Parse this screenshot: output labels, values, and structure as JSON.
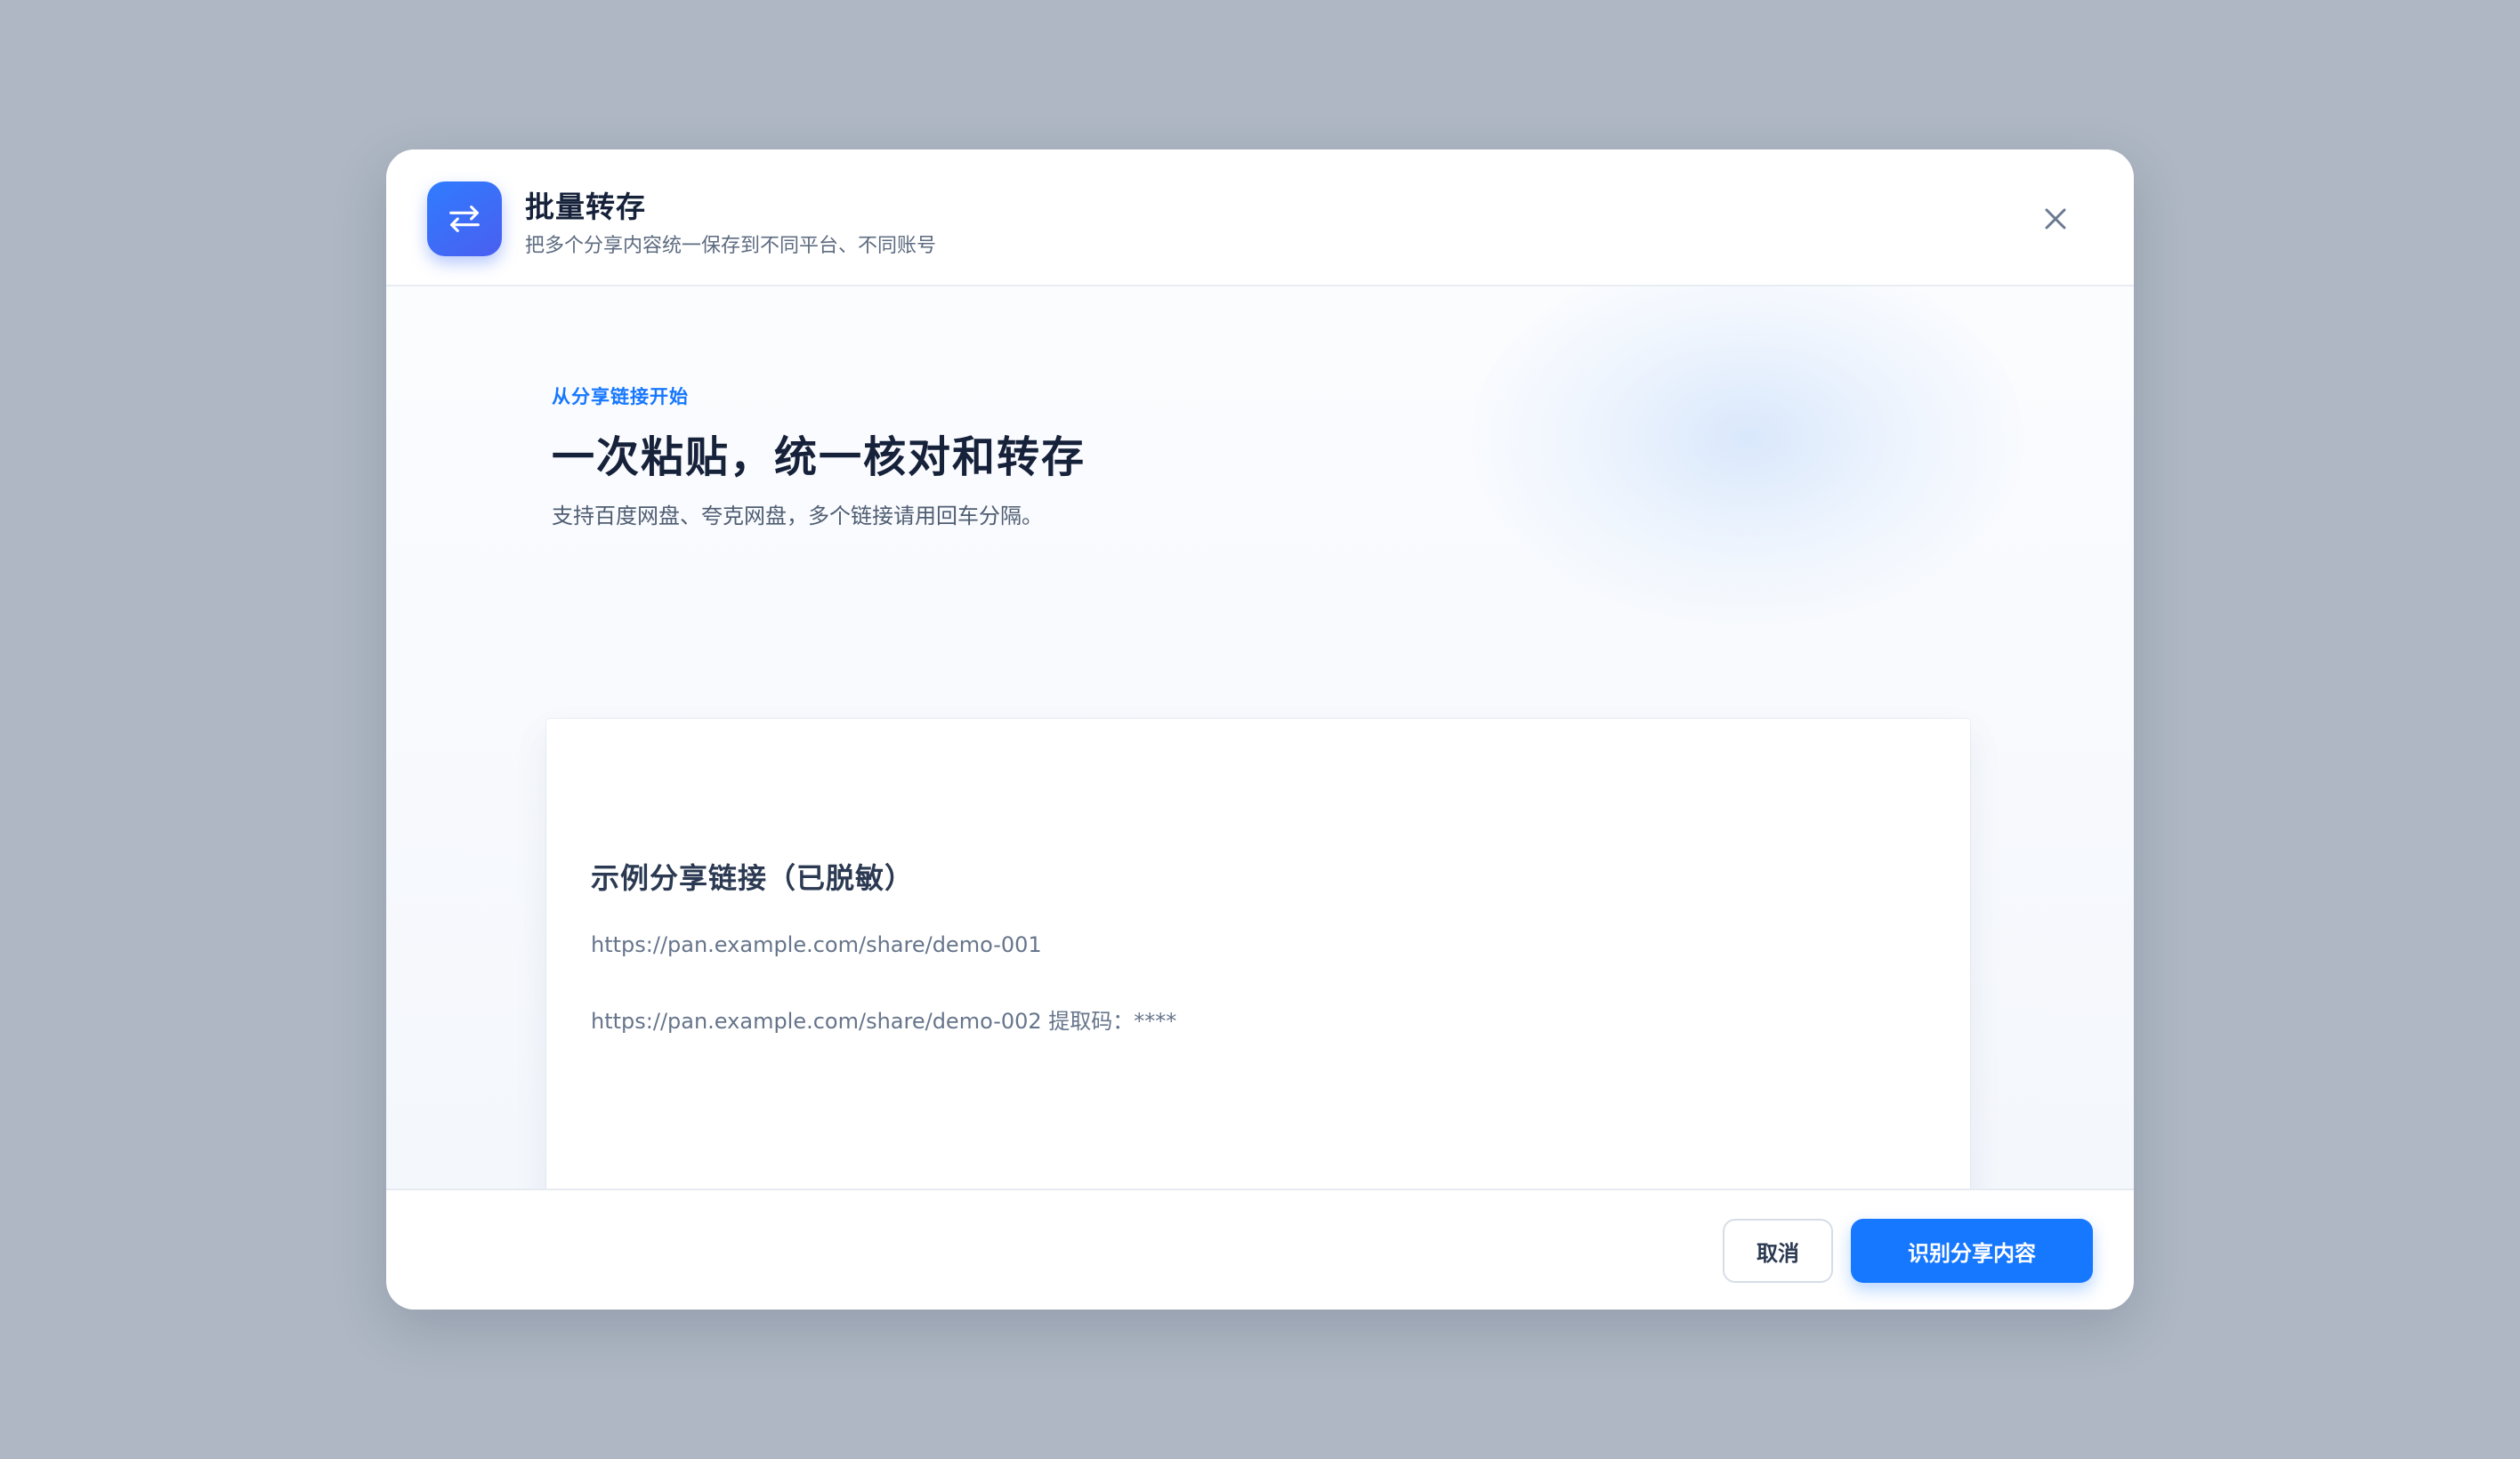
{
  "dialog": {
    "title": "批量转存",
    "subtitle": "把多个分享内容统一保存到不同平台、不同账号",
    "icon": "transfer-arrows-icon",
    "close_icon": "close-icon"
  },
  "intro": {
    "eyebrow": "从分享链接开始",
    "headline": "一次粘贴，统一核对和转存",
    "description": "支持百度网盘、夸克网盘，多个链接请用回车分隔。"
  },
  "paste_area": {
    "heading": "示例分享链接（已脱敏）",
    "lines": [
      "https://pan.example.com/share/demo-001",
      "https://pan.example.com/share/demo-002   提取码：****"
    ]
  },
  "footer": {
    "cancel_label": "取消",
    "submit_label": "识别分享内容"
  },
  "colors": {
    "backdrop": "#aeb7c3",
    "accent": "#1677ff",
    "title_text": "#16213a",
    "muted_text": "#5d6b80"
  }
}
